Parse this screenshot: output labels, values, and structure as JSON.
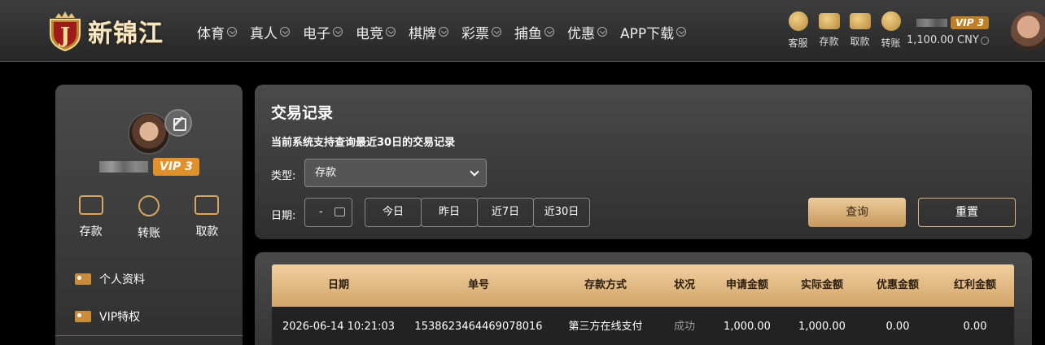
{
  "brand": {
    "name": "新锦江",
    "logo_letter": "J"
  },
  "nav": [
    "体育",
    "真人",
    "电子",
    "电竞",
    "棋牌",
    "彩票",
    "捕鱼",
    "优惠",
    "APP下载"
  ],
  "header_actions": [
    {
      "label": "客服",
      "icon": "customer-service-icon"
    },
    {
      "label": "存款",
      "icon": "wallet-icon"
    },
    {
      "label": "取款",
      "icon": "briefcase-icon"
    },
    {
      "label": "转账",
      "icon": "yuan-coin-icon"
    }
  ],
  "user": {
    "vip": "VIP 3",
    "balance": "1,100.00 CNY"
  },
  "sidebar": {
    "actions": [
      {
        "label": "存款",
        "icon": "wallet-icon"
      },
      {
        "label": "转账",
        "icon": "transfer-icon"
      },
      {
        "label": "取款",
        "icon": "card-icon"
      }
    ],
    "menu": [
      {
        "label": "个人资料",
        "icon": "id-card-icon"
      },
      {
        "label": "VIP特权",
        "icon": "vip-card-icon"
      }
    ]
  },
  "panel": {
    "title": "交易记录",
    "subtitle": "当前系统支持查询最近30日的交易记录",
    "type_label": "类型:",
    "type_value": "存款",
    "date_label": "日期:",
    "date_value": "-",
    "quick_ranges": [
      "今日",
      "昨日",
      "近7日",
      "近30日"
    ],
    "query_label": "查询",
    "reset_label": "重置"
  },
  "table": {
    "columns": [
      "日期",
      "单号",
      "存款方式",
      "状况",
      "申请金额",
      "实际金额",
      "优惠金额",
      "红利金额"
    ],
    "rows": [
      [
        "2026-06-14 10:21:03",
        "1538623464469078016",
        "第三方在线支付",
        "成功",
        "1,000.00",
        "1,000.00",
        "0.00",
        "0.00"
      ]
    ]
  }
}
